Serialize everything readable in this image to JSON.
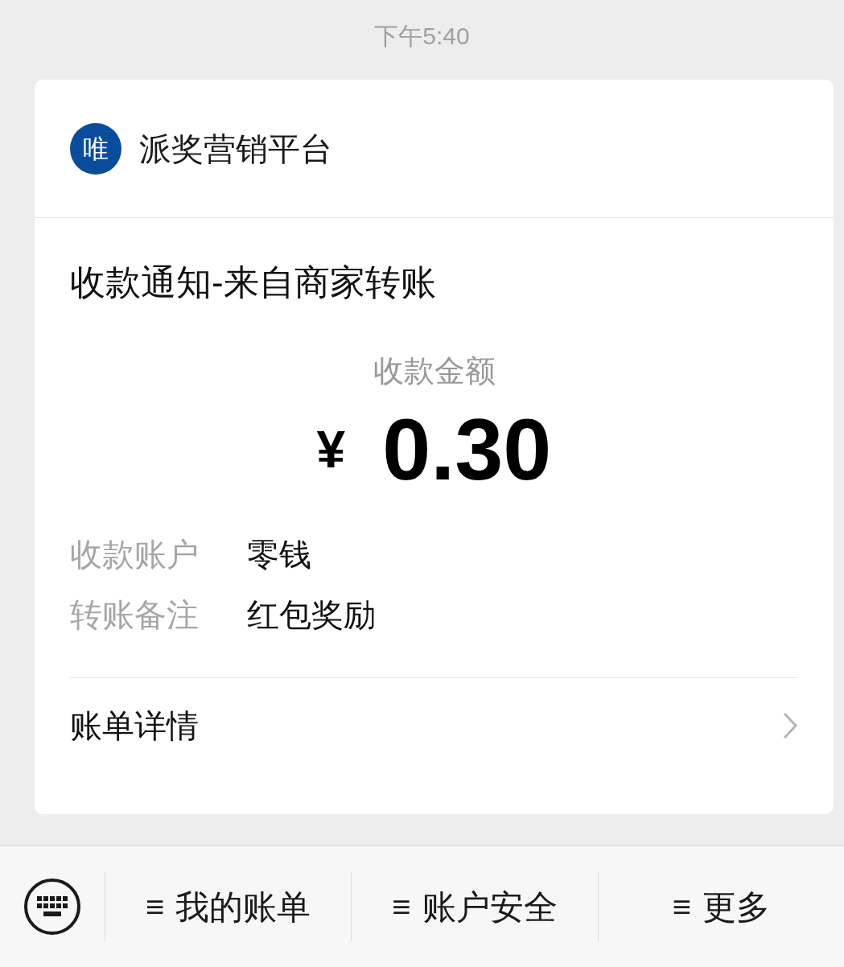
{
  "timestamp": "下午5:40",
  "card": {
    "sender": {
      "avatar_text": "唯",
      "name": "派奖营销平台"
    },
    "title": "收款通知-来自商家转账",
    "amount_label": "收款金额",
    "currency": "¥",
    "amount": "0.30",
    "details": [
      {
        "label": "收款账户",
        "value": "零钱"
      },
      {
        "label": "转账备注",
        "value": "红包奖励"
      }
    ],
    "link": "账单详情"
  },
  "menu": [
    {
      "icon": "≡",
      "label": "我的账单"
    },
    {
      "icon": "≡",
      "label": "账户安全"
    },
    {
      "icon": "≡",
      "label": "更多"
    }
  ]
}
